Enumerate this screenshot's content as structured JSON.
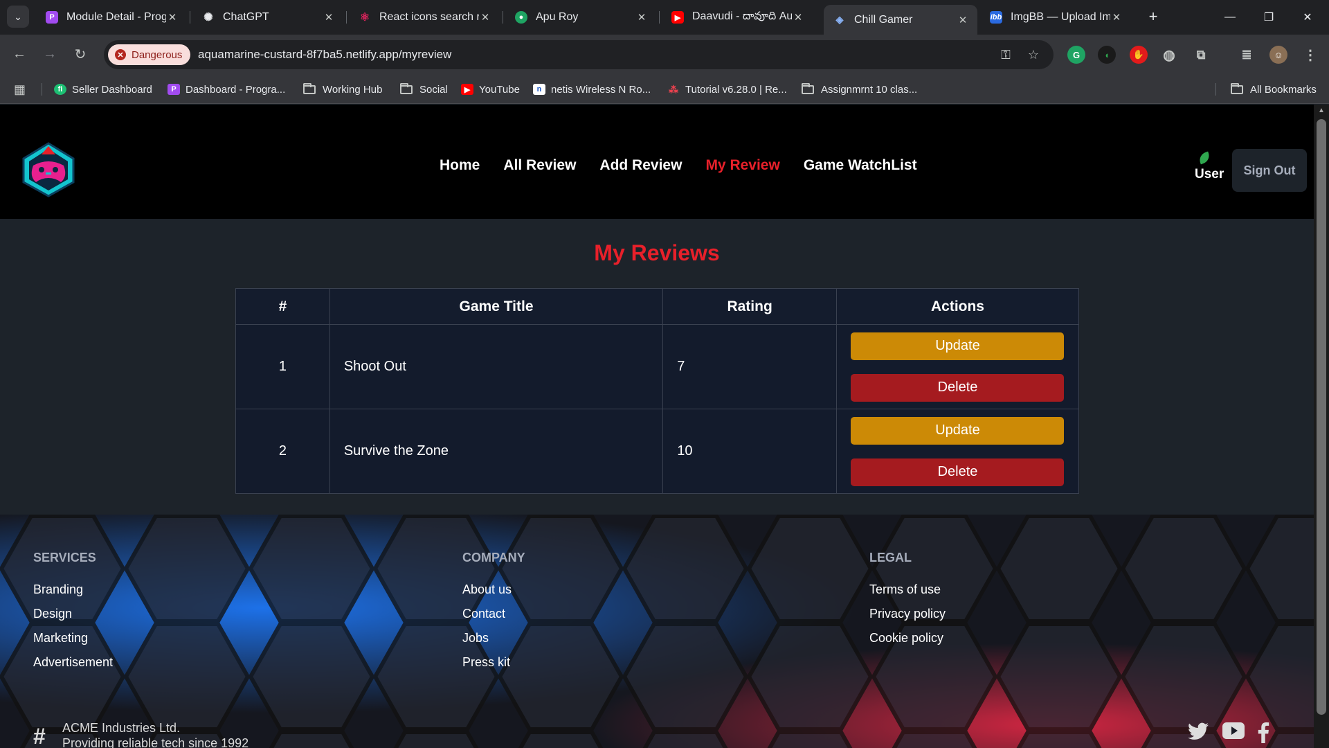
{
  "browser": {
    "tabs": [
      {
        "title": "Module Detail - Prog",
        "favicon": "programming-hero-icon",
        "color": "#a24bf0"
      },
      {
        "title": "ChatGPT",
        "favicon": "chatgpt-icon",
        "color": "#3a3b3f"
      },
      {
        "title": "React icons search re",
        "favicon": "react-icons-icon",
        "color": "#e0245e"
      },
      {
        "title": "Apu Roy",
        "favicon": "chat-icon",
        "color": "#1fa463"
      },
      {
        "title": "Daavudi - దావూది Au",
        "favicon": "youtube-icon",
        "color": "#ff0000"
      },
      {
        "title": "Chill Gamer",
        "favicon": "game-icon",
        "color": "#3a6ea5"
      },
      {
        "title": "ImgBB — Upload Ima",
        "favicon": "imgbb-icon",
        "color": "#2a6ae0"
      }
    ],
    "active_tab": 5,
    "security_chip": "Dangerous",
    "url_host": "aquamarine-custard-8f7ba5.netlify.app",
    "url_path": "/myreview",
    "bookmarks": [
      {
        "label": "Seller Dashboard",
        "icon": "fiverr-icon",
        "color": "#1dbf73"
      },
      {
        "label": "Dashboard - Progra...",
        "icon": "programming-hero-icon",
        "color": "#a24bf0"
      },
      {
        "label": "Working Hub",
        "icon": "folder-icon"
      },
      {
        "label": "Social",
        "icon": "folder-icon"
      },
      {
        "label": "YouTube",
        "icon": "youtube-icon",
        "color": "#ff0000"
      },
      {
        "label": "netis Wireless N Ro...",
        "icon": "netis-icon",
        "color": "#1a56c4"
      },
      {
        "label": "Tutorial v6.28.0 | Re...",
        "icon": "react-router-icon",
        "color": "#f44250"
      },
      {
        "label": "Assignmrnt 10 clas...",
        "icon": "folder-icon"
      }
    ],
    "all_bookmarks": "All Bookmarks"
  },
  "site": {
    "nav": [
      "Home",
      "All Review",
      "Add Review",
      "My Review",
      "Game WatchList"
    ],
    "active_nav": "My Review",
    "user_label": "User",
    "sign_out": "Sign Out",
    "accent": "#e8202a"
  },
  "main": {
    "title": "My Reviews",
    "columns": [
      "#",
      "Game Title",
      "Rating",
      "Actions"
    ],
    "rows": [
      {
        "num": "1",
        "title": "Shoot Out",
        "rating": "7",
        "update": "Update",
        "delete": "Delete"
      },
      {
        "num": "2",
        "title": "Survive the Zone",
        "rating": "10",
        "update": "Update",
        "delete": "Delete"
      }
    ]
  },
  "footer": {
    "services": {
      "heading": "SERVICES",
      "links": [
        "Branding",
        "Design",
        "Marketing",
        "Advertisement"
      ]
    },
    "company": {
      "heading": "COMPANY",
      "links": [
        "About us",
        "Contact",
        "Jobs",
        "Press kit"
      ]
    },
    "legal": {
      "heading": "LEGAL",
      "links": [
        "Terms of use",
        "Privacy policy",
        "Cookie policy"
      ]
    },
    "brand_name": "ACME Industries Ltd.",
    "brand_tagline": "Providing reliable tech since 1992",
    "social": [
      "twitter-icon",
      "youtube-icon",
      "facebook-icon"
    ]
  }
}
